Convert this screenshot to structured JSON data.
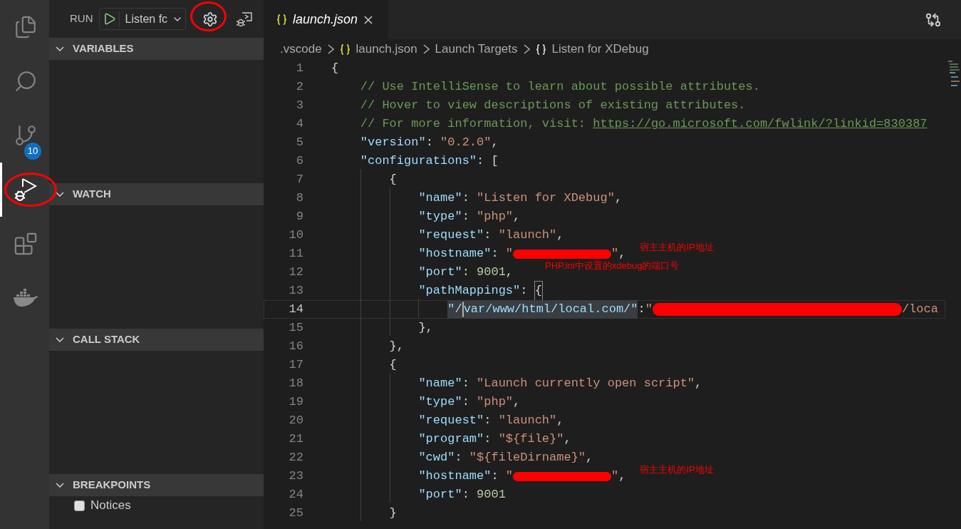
{
  "activity_bar": {
    "items": [
      {
        "kind": "files",
        "selected": false
      },
      {
        "kind": "search",
        "selected": false
      },
      {
        "kind": "source-control",
        "selected": false,
        "badge": "10"
      },
      {
        "kind": "run",
        "selected": true,
        "circled": true
      },
      {
        "kind": "extensions",
        "selected": false
      },
      {
        "kind": "docker",
        "selected": false
      }
    ]
  },
  "sidebar": {
    "title": "RUN",
    "config_dropdown": {
      "value": "Listen fc"
    },
    "settings_circled": true,
    "sections": [
      {
        "title": "VARIABLES",
        "expanded": true
      },
      {
        "title": "WATCH",
        "expanded": true
      },
      {
        "title": "CALL STACK",
        "expanded": true
      },
      {
        "title": "BREAKPOINTS",
        "expanded": true,
        "items": [
          {
            "label": "Notices",
            "checked": false
          }
        ]
      }
    ]
  },
  "editor": {
    "tabs": [
      {
        "label": "launch.json",
        "selected": true
      }
    ],
    "breadcrumb": [
      {
        "label": ".vscode",
        "icon": false
      },
      {
        "label": "launch.json",
        "icon": true
      },
      {
        "label": "Launch Targets",
        "icon": false
      },
      {
        "label": "Listen for XDebug",
        "icon": true
      }
    ],
    "lines": [
      {
        "number": "1",
        "current": false,
        "tokens": [
          {
            "kind": "punct",
            "text": "{"
          }
        ]
      },
      {
        "number": "2",
        "current": false,
        "tokens": [
          {
            "kind": "comment",
            "text": "    // Use IntelliSense to learn about possible attributes."
          }
        ]
      },
      {
        "number": "3",
        "current": false,
        "tokens": [
          {
            "kind": "comment",
            "text": "    // Hover to view descriptions of existing attributes."
          }
        ]
      },
      {
        "number": "4",
        "current": false,
        "tokens": [
          {
            "kind": "comment",
            "text": "    // For more information, visit: "
          },
          {
            "kind": "link",
            "text": "https://go.microsoft.com/fwlink/?linkid=830387"
          }
        ]
      },
      {
        "number": "5",
        "current": false,
        "tokens": [
          {
            "kind": "key",
            "text": "    \"version\""
          },
          {
            "kind": "punct",
            "text": ": "
          },
          {
            "kind": "string",
            "text": "\"0.2.0\""
          },
          {
            "kind": "punct",
            "text": ","
          }
        ]
      },
      {
        "number": "6",
        "current": false,
        "tokens": [
          {
            "kind": "key",
            "text": "    \"configurations\""
          },
          {
            "kind": "punct",
            "text": ": ["
          }
        ]
      },
      {
        "number": "7",
        "current": false,
        "tokens": [
          {
            "kind": "punct",
            "text": "        {"
          }
        ]
      },
      {
        "number": "8",
        "current": false,
        "tokens": [
          {
            "kind": "key",
            "text": "            \"name\""
          },
          {
            "kind": "punct",
            "text": ": "
          },
          {
            "kind": "string",
            "text": "\"Listen for XDebug\""
          },
          {
            "kind": "punct",
            "text": ","
          }
        ]
      },
      {
        "number": "9",
        "current": false,
        "tokens": [
          {
            "kind": "key",
            "text": "            \"type\""
          },
          {
            "kind": "punct",
            "text": ": "
          },
          {
            "kind": "string",
            "text": "\"php\""
          },
          {
            "kind": "punct",
            "text": ","
          }
        ]
      },
      {
        "number": "10",
        "current": false,
        "tokens": [
          {
            "kind": "key",
            "text": "            \"request\""
          },
          {
            "kind": "punct",
            "text": ": "
          },
          {
            "kind": "string",
            "text": "\"launch\""
          },
          {
            "kind": "punct",
            "text": ","
          }
        ]
      },
      {
        "number": "11",
        "current": false,
        "tokens": [
          {
            "kind": "key",
            "text": "            \"hostname\""
          },
          {
            "kind": "punct",
            "text": ": "
          },
          {
            "kind": "string",
            "text": "\""
          },
          {
            "kind": "redaction-short"
          },
          {
            "kind": "string",
            "text": "\""
          },
          {
            "kind": "punct",
            "text": ","
          }
        ],
        "note": "宿主主机的IP地址"
      },
      {
        "number": "12",
        "current": false,
        "tokens": [
          {
            "kind": "key",
            "text": "            \"port\""
          },
          {
            "kind": "punct",
            "text": ": "
          },
          {
            "kind": "number",
            "text": "9001"
          },
          {
            "kind": "punct",
            "text": ","
          }
        ],
        "note": "PHP.ini中设置的xdebug的端口号"
      },
      {
        "number": "13",
        "current": false,
        "tokens": [
          {
            "kind": "key",
            "text": "            \"pathMappings\""
          },
          {
            "kind": "punct",
            "text": ": "
          },
          {
            "kind": "bracket-match",
            "text": "{"
          }
        ]
      },
      {
        "number": "14",
        "current": true,
        "tokens": [
          {
            "kind": "selected-key",
            "text": "                \"/"
          },
          {
            "kind": "cursor"
          },
          {
            "kind": "selected-key",
            "text": "var/www/html/local.com/\""
          },
          {
            "kind": "punct",
            "text": ":"
          },
          {
            "kind": "string",
            "text": "\""
          },
          {
            "kind": "redaction-long"
          },
          {
            "kind": "string",
            "text": "/loca"
          }
        ]
      },
      {
        "number": "15",
        "current": false,
        "tokens": [
          {
            "kind": "punct",
            "text": "            },"
          }
        ]
      },
      {
        "number": "16",
        "current": false,
        "tokens": [
          {
            "kind": "punct",
            "text": "        },"
          }
        ]
      },
      {
        "number": "17",
        "current": false,
        "tokens": [
          {
            "kind": "punct",
            "text": "        {"
          }
        ]
      },
      {
        "number": "18",
        "current": false,
        "tokens": [
          {
            "kind": "key",
            "text": "            \"name\""
          },
          {
            "kind": "punct",
            "text": ": "
          },
          {
            "kind": "string",
            "text": "\"Launch currently open script\""
          },
          {
            "kind": "punct",
            "text": ","
          }
        ]
      },
      {
        "number": "19",
        "current": false,
        "tokens": [
          {
            "kind": "key",
            "text": "            \"type\""
          },
          {
            "kind": "punct",
            "text": ": "
          },
          {
            "kind": "string",
            "text": "\"php\""
          },
          {
            "kind": "punct",
            "text": ","
          }
        ]
      },
      {
        "number": "20",
        "current": false,
        "tokens": [
          {
            "kind": "key",
            "text": "            \"request\""
          },
          {
            "kind": "punct",
            "text": ": "
          },
          {
            "kind": "string",
            "text": "\"launch\""
          },
          {
            "kind": "punct",
            "text": ","
          }
        ]
      },
      {
        "number": "21",
        "current": false,
        "tokens": [
          {
            "kind": "key",
            "text": "            \"program\""
          },
          {
            "kind": "punct",
            "text": ": "
          },
          {
            "kind": "string",
            "text": "\"${file}\""
          },
          {
            "kind": "punct",
            "text": ","
          }
        ]
      },
      {
        "number": "22",
        "current": false,
        "tokens": [
          {
            "kind": "key",
            "text": "            \"cwd\""
          },
          {
            "kind": "punct",
            "text": ": "
          },
          {
            "kind": "string",
            "text": "\"${fileDirname}\""
          },
          {
            "kind": "punct",
            "text": ","
          }
        ]
      },
      {
        "number": "23",
        "current": false,
        "tokens": [
          {
            "kind": "key",
            "text": "            \"hostname\""
          },
          {
            "kind": "punct",
            "text": ": "
          },
          {
            "kind": "string",
            "text": "\""
          },
          {
            "kind": "redaction-short"
          },
          {
            "kind": "string",
            "text": "\""
          },
          {
            "kind": "punct",
            "text": ","
          }
        ],
        "note": "宿主主机的IP地址"
      },
      {
        "number": "24",
        "current": false,
        "tokens": [
          {
            "kind": "key",
            "text": "            \"port\""
          },
          {
            "kind": "punct",
            "text": ": "
          },
          {
            "kind": "number",
            "text": "9001"
          }
        ]
      },
      {
        "number": "25",
        "current": false,
        "tokens": [
          {
            "kind": "punct",
            "text": "        }"
          }
        ]
      }
    ]
  }
}
